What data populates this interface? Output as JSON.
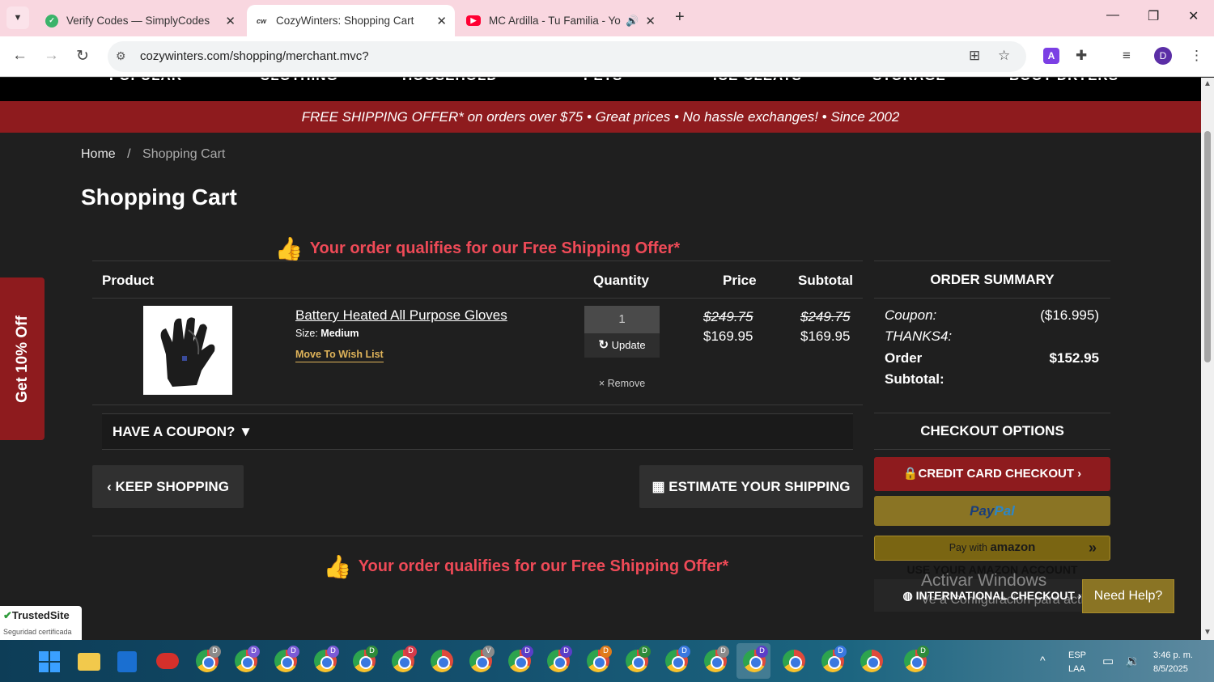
{
  "browser": {
    "tabs": [
      {
        "title": "Verify Codes — SimplyCodes",
        "favicon_color": "#3bb36a",
        "active": false
      },
      {
        "title": "CozyWinters: Shopping Cart",
        "favicon_text": "cw",
        "active": true
      },
      {
        "title": "MC Ardilla - Tu Familia - Yo",
        "favicon_color": "#ff0033",
        "active": false
      }
    ],
    "url": "cozywinters.com/shopping/merchant.mvc?",
    "profile_initial": "D",
    "ext_initial": "A"
  },
  "nav": {
    "items": [
      "POPULAR",
      "CLOTHING",
      "HOUSEHOLD",
      "PETS",
      "ICE CLEATS",
      "STORAGE",
      "BOOT DRYERS"
    ]
  },
  "promo": {
    "text": "FREE SHIPPING OFFER* on orders over $75  •  Great prices  •  No hassle exchanges!  •  Since 2002"
  },
  "breadcrumb": {
    "home": "Home",
    "separator": "/",
    "current": "Shopping Cart"
  },
  "page_title": "Shopping Cart",
  "qualify_text": "Your order qualifies for our Free Shipping Offer*",
  "cart": {
    "headers": {
      "product": "Product",
      "quantity": "Quantity",
      "price": "Price",
      "subtotal": "Subtotal"
    },
    "item": {
      "name": "Battery Heated All Purpose Gloves",
      "size_label": "Size:",
      "size_value": "Medium",
      "wish": "Move To Wish List",
      "qty": "1",
      "update": "Update",
      "remove": "× Remove",
      "price_old": "$249.75",
      "price_new": "$169.95",
      "subtotal_old": "$249.75",
      "subtotal_new": "$169.95"
    },
    "coupon_toggle": "HAVE A COUPON? ▼",
    "keep_shopping": "KEEP SHOPPING",
    "estimate_shipping": "ESTIMATE YOUR SHIPPING"
  },
  "summary": {
    "title": "ORDER SUMMARY",
    "coupon_label": "Coupon:",
    "coupon_code": "THANKS4:",
    "coupon_value": "($16.995)",
    "order_label": "Order",
    "subtotal_label": "Subtotal:",
    "order_value": "$152.95"
  },
  "checkout": {
    "title": "CHECKOUT OPTIONS",
    "credit_card": "CREDIT CARD CHECKOUT",
    "paypal_pay": "Pay",
    "paypal_pal": "Pal",
    "amazon_pay": "Pay with",
    "amazon_brand": "amazon",
    "amazon_account": "USE YOUR AMAZON ACCOUNT",
    "international": "INTERNATIONAL CHECKOUT"
  },
  "watermark": {
    "line1": "Activar Windows",
    "line2": "Ve a Configuración para activar Windows."
  },
  "need_help": "Need Help?",
  "side_tab": "Get 10% Off",
  "trusted": {
    "title": "TrustedSite",
    "subtitle": "Seguridad certificada"
  },
  "tray": {
    "lang": "ESP",
    "region": "LAA",
    "time": "3:46 p. m.",
    "date": "8/5/2025"
  },
  "colors": {
    "accent_red": "#8e1b1e",
    "qualify_red": "#ee4a57",
    "gold": "#8a7424",
    "wish_gold": "#e0b45a"
  }
}
